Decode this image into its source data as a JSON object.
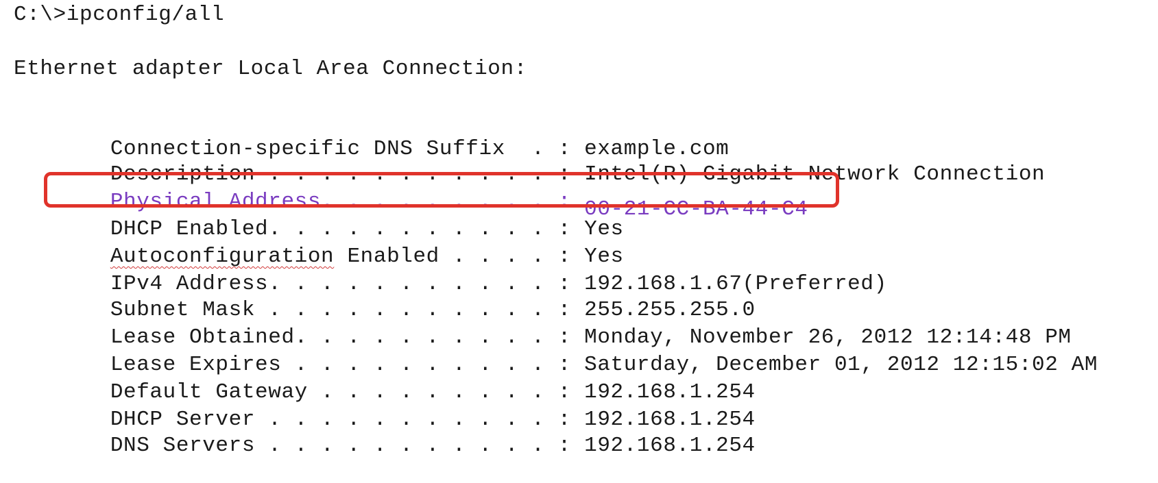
{
  "command_line": "C:\\>ipconfig/all",
  "adapter_title": "Ethernet adapter Local Area Connection:",
  "highlight_color": "#7a3cc0",
  "highlight_box_color": "#e0332b",
  "entries": [
    {
      "label": "Connection-specific DNS Suffix  . :",
      "value": "example.com"
    },
    {
      "label": "Description . . . . . . . . . . . :",
      "value": "Intel(R) Gigabit Network Connection"
    },
    {
      "label": "Physical Address. . . . . . . . . :",
      "value": "00-21-CC-BA-44-C4"
    },
    {
      "label": "DHCP Enabled. . . . . . . . . . . :",
      "value": "Yes"
    },
    {
      "label_part1": "Autoconfiguration",
      "label_part2": " Enabled . . . . :",
      "value": "Yes"
    },
    {
      "label": "IPv4 Address. . . . . . . . . . . :",
      "value": "192.168.1.67(Preferred)"
    },
    {
      "label": "Subnet Mask . . . . . . . . . . . :",
      "value": "255.255.255.0"
    },
    {
      "label": "Lease Obtained. . . . . . . . . . :",
      "value": "Monday, November 26, 2012 12:14:48 PM"
    },
    {
      "label": "Lease Expires . . . . . . . . . . :",
      "value": "Saturday, December 01, 2012 12:15:02 AM"
    },
    {
      "label": "Default Gateway . . . . . . . . . :",
      "value": "192.168.1.254"
    },
    {
      "label": "DHCP Server . . . . . . . . . . . :",
      "value": "192.168.1.254"
    },
    {
      "label": "DNS Servers . . . . . . . . . . . :",
      "value": "192.168.1.254"
    }
  ]
}
